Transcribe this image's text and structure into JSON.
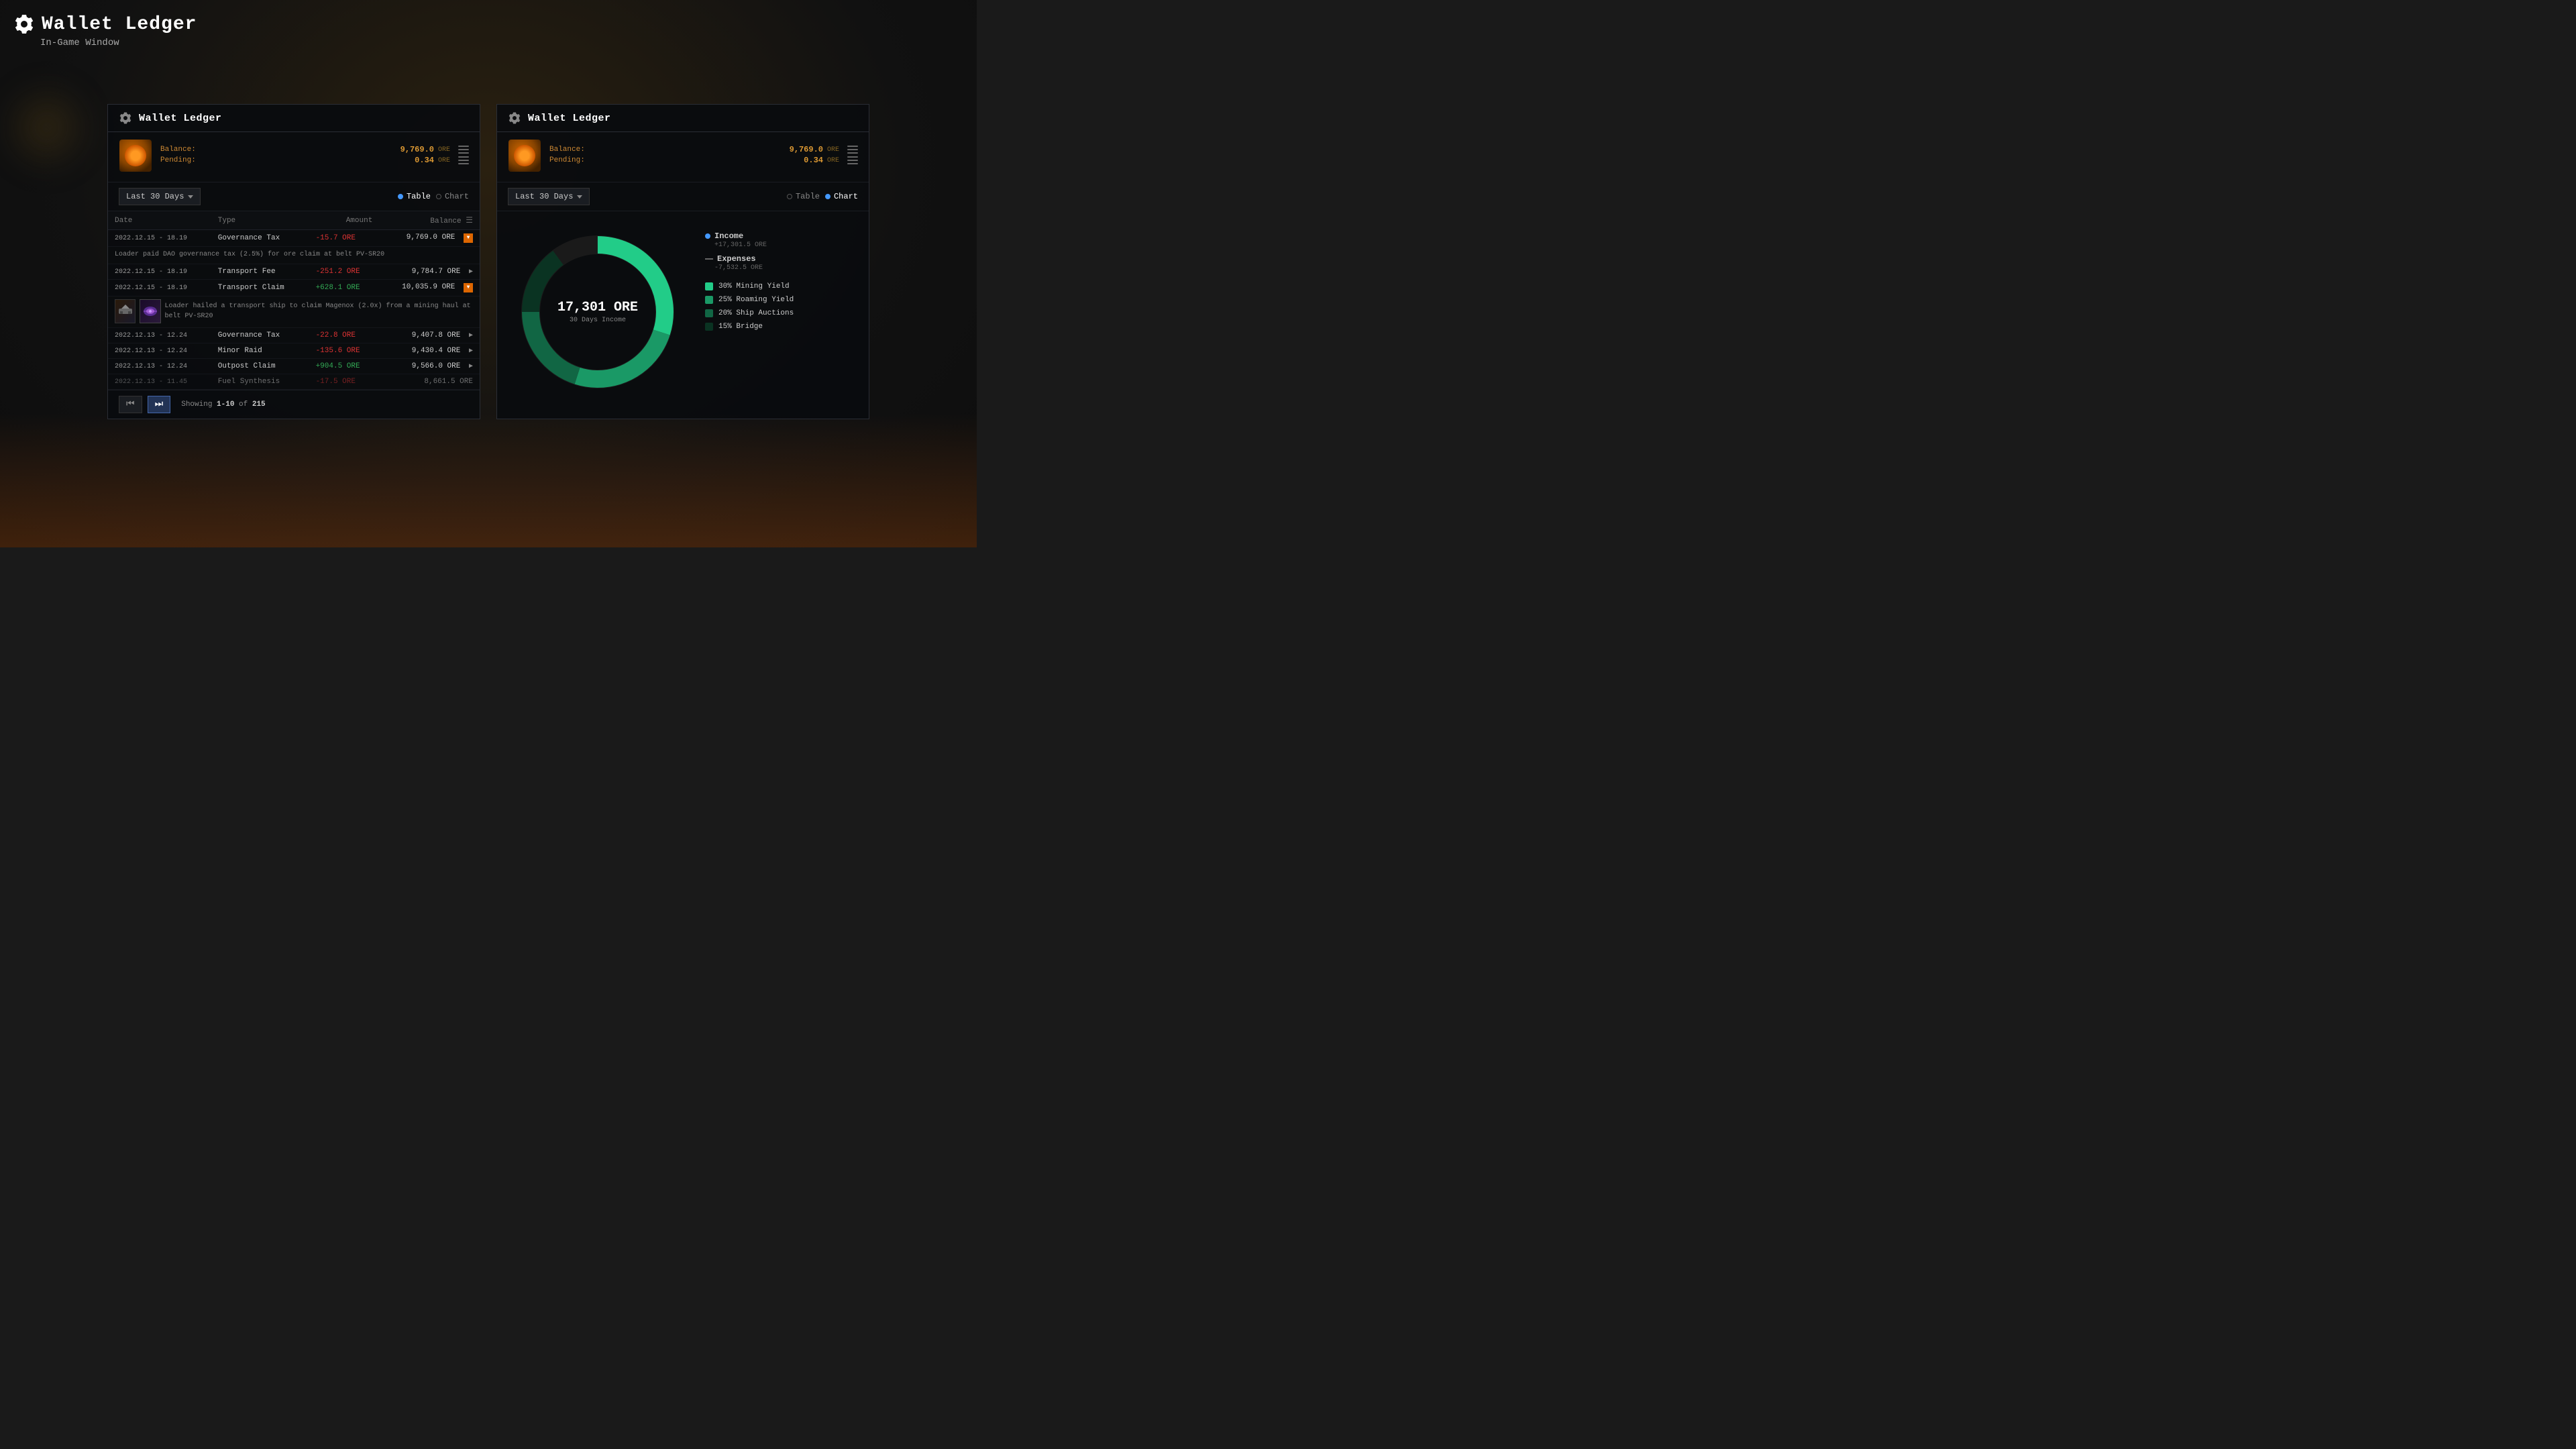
{
  "page": {
    "title": "Wallet Ledger",
    "subtitle": "In-Game Window",
    "title_icon": "⚙"
  },
  "left_window": {
    "title": "Wallet Ledger",
    "balance_label": "Balance:",
    "balance_amount": "9,769.0",
    "balance_currency": "ORE",
    "pending_label": "Pending:",
    "pending_amount": "0.34",
    "pending_currency": "ORE",
    "filter": "Last 30 Days",
    "view_table": "Table",
    "view_chart": "Chart",
    "active_view": "table",
    "columns": [
      "Date",
      "Type",
      "Amount",
      "Balance"
    ],
    "rows": [
      {
        "date": "2022.12.15 - 18.19",
        "type": "Governance Tax",
        "amount": "-15.7 ORE",
        "amount_sign": "neg",
        "balance": "9,769.0 ORE",
        "expanded": true,
        "detail": "Loader paid DAO governance tax (2.5%) for ore claim at belt PV-SR20",
        "has_icons": false
      },
      {
        "date": "2022.12.15 - 18.19",
        "type": "Transport Fee",
        "amount": "-251.2 ORE",
        "amount_sign": "neg",
        "balance": "9,784.7 ORE",
        "expanded": false
      },
      {
        "date": "2022.12.15 - 18.19",
        "type": "Transport Claim",
        "amount": "+628.1 ORE",
        "amount_sign": "pos",
        "balance": "10,035.9 ORE",
        "expanded": true,
        "detail": "Loader hailed a transport ship to claim Magenox (2.0x) from a mining haul at belt PV-SR20",
        "has_icons": true
      },
      {
        "date": "2022.12.13 - 12.24",
        "type": "Governance Tax",
        "amount": "-22.8 ORE",
        "amount_sign": "neg",
        "balance": "9,407.8 ORE",
        "expanded": false
      },
      {
        "date": "2022.12.13 - 12.24",
        "type": "Minor Raid",
        "amount": "-135.6 ORE",
        "amount_sign": "neg",
        "balance": "9,430.4 ORE",
        "expanded": false
      },
      {
        "date": "2022.12.13 - 12.24",
        "type": "Outpost Claim",
        "amount": "+904.5 ORE",
        "amount_sign": "pos",
        "balance": "9,566.0 ORE",
        "expanded": false
      },
      {
        "date": "2022.12.13 - 11.45",
        "type": "Fuel Synthesis",
        "amount": "-17.5 ORE",
        "amount_sign": "neg",
        "balance": "8,661.5 ORE",
        "expanded": false,
        "partial": true
      }
    ],
    "pagination": {
      "showing_start": "1",
      "showing_end": "10",
      "total": "215",
      "showing_label": "Showing",
      "of_label": "of"
    }
  },
  "right_window": {
    "title": "Wallet Ledger",
    "balance_label": "Balance:",
    "balance_amount": "9,769.0",
    "balance_currency": "ORE",
    "pending_label": "Pending:",
    "pending_amount": "0.34",
    "pending_currency": "ORE",
    "filter": "Last 30 Days",
    "view_table": "Table",
    "view_chart": "Chart",
    "active_view": "chart",
    "chart": {
      "center_value": "17,301 ORE",
      "center_label": "30 Days Income",
      "segments": [
        {
          "label": "Mining Yield",
          "percent": 30,
          "color": "#22cc88",
          "stroke_dash": "125 418"
        },
        {
          "label": "Roaming Yield",
          "percent": 25,
          "color": "#1a9966",
          "stroke_dash": "104 418"
        },
        {
          "label": "Ship Auctions",
          "percent": 20,
          "color": "#116644",
          "stroke_dash": "83 418"
        },
        {
          "label": "Bridge",
          "percent": 15,
          "color": "#0a3322",
          "stroke_dash": "63 418"
        }
      ],
      "income_label": "Income",
      "income_value": "+17,301.5 ORE",
      "income_color": "#4499ff",
      "expenses_label": "Expenses",
      "expenses_value": "-7,532.5 ORE",
      "legend_items": [
        {
          "label": "30% Mining Yield",
          "color": "#22cc88"
        },
        {
          "label": "25% Roaming Yield",
          "color": "#1a9966"
        },
        {
          "label": "20% Ship Auctions",
          "color": "#116644"
        },
        {
          "label": "15% Bridge",
          "color": "#0a3322"
        }
      ]
    }
  }
}
